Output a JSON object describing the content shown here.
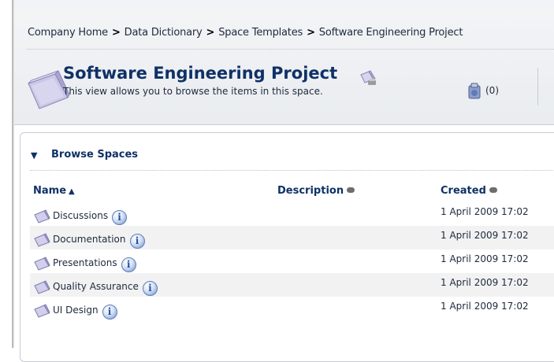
{
  "breadcrumb": [
    {
      "label": "Company Home"
    },
    {
      "label": "Data Dictionary"
    },
    {
      "label": "Space Templates"
    },
    {
      "label": "Software Engineering Project"
    }
  ],
  "breadcrumb_separator": ">",
  "space": {
    "title": "Software Engineering Project",
    "description": "This view allows you to browse the items in this space."
  },
  "clipboard": {
    "count_label": "(0)",
    "icon": "clipboard-icon"
  },
  "browse": {
    "toggle_symbol": "▼",
    "title": "Browse Spaces",
    "columns": {
      "name": "Name",
      "description": "Description",
      "created": "Created"
    },
    "sort_indicator": "▲",
    "rows": [
      {
        "name": "Discussions",
        "description": "",
        "created": "1 April 2009 17:02"
      },
      {
        "name": "Documentation",
        "description": "",
        "created": "1 April 2009 17:02"
      },
      {
        "name": "Presentations",
        "description": "",
        "created": "1 April 2009 17:02"
      },
      {
        "name": "Quality Assurance",
        "description": "",
        "created": "1 April 2009 17:02"
      },
      {
        "name": "UI Design",
        "description": "",
        "created": "1 April 2009 17:02"
      }
    ]
  },
  "colors": {
    "title_blue": "#0f3167",
    "header_bg": "#eceff3",
    "row_alt": "#f2f2f2"
  }
}
